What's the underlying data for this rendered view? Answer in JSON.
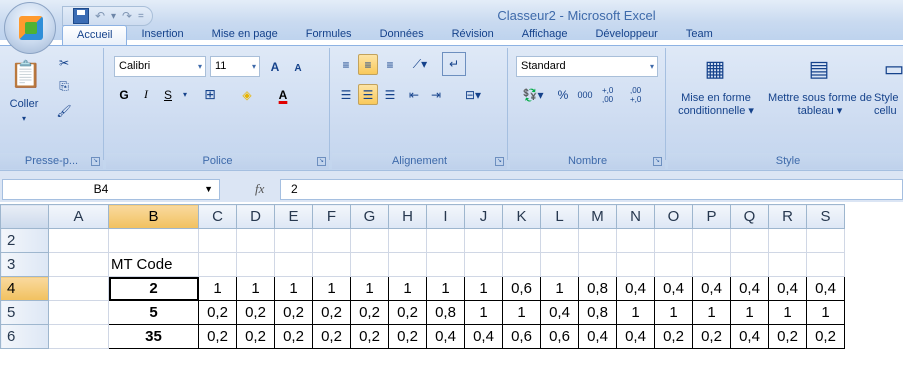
{
  "window": {
    "title": "Classeur2 - Microsoft Excel"
  },
  "qat": {
    "save_icon": "save-icon",
    "undo_icon": "undo-icon",
    "redo_icon": "redo-icon",
    "sep": "="
  },
  "tabs": [
    "Accueil",
    "Insertion",
    "Mise en page",
    "Formules",
    "Données",
    "Révision",
    "Affichage",
    "Développeur",
    "Team"
  ],
  "ribbon": {
    "clipboard": {
      "label": "Presse-p...",
      "paste": "Coller"
    },
    "font": {
      "label": "Police",
      "name": "Calibri",
      "size": "11",
      "bold": "G",
      "italic": "I",
      "underline": "S",
      "grow": "A",
      "shrink": "A",
      "color_a": "A"
    },
    "alignment": {
      "label": "Alignement"
    },
    "number": {
      "label": "Nombre",
      "format": "Standard",
      "percent": "%",
      "thousands": "000",
      "inc_dec": "+,0 ,00",
      "dec_dec": ",00 +,0"
    },
    "style": {
      "label": "Style",
      "cond": "Mise en forme conditionnelle ▾",
      "table": "Mettre sous forme de tableau ▾",
      "cell": "Style cellu"
    }
  },
  "formula_bar": {
    "name_box": "B4",
    "fx": "fx",
    "value": "2"
  },
  "grid": {
    "columns": [
      "A",
      "B",
      "C",
      "D",
      "E",
      "F",
      "G",
      "H",
      "I",
      "J",
      "K",
      "L",
      "M",
      "N",
      "O",
      "P",
      "Q",
      "R",
      "S"
    ],
    "rows": [
      {
        "num": "2",
        "cells": [
          "",
          "",
          "",
          "",
          "",
          "",
          "",
          "",
          "",
          "",
          "",
          "",
          "",
          "",
          "",
          "",
          "",
          "",
          ""
        ]
      },
      {
        "num": "3",
        "cells": [
          "",
          "MT Code",
          "",
          "",
          "",
          "",
          "",
          "",
          "",
          "",
          "",
          "",
          "",
          "",
          "",
          "",
          "",
          "",
          ""
        ]
      },
      {
        "num": "4",
        "cells": [
          "",
          "2",
          "1",
          "1",
          "1",
          "1",
          "1",
          "1",
          "1",
          "1",
          "0,6",
          "1",
          "0,8",
          "0,4",
          "0,4",
          "0,4",
          "0,4",
          "0,4",
          "0,4"
        ]
      },
      {
        "num": "5",
        "cells": [
          "",
          "5",
          "0,2",
          "0,2",
          "0,2",
          "0,2",
          "0,2",
          "0,2",
          "0,8",
          "1",
          "1",
          "0,4",
          "0,8",
          "1",
          "1",
          "1",
          "1",
          "1",
          "1"
        ]
      },
      {
        "num": "6",
        "cells": [
          "",
          "35",
          "0,2",
          "0,2",
          "0,2",
          "0,2",
          "0,2",
          "0,2",
          "0,4",
          "0,4",
          "0,6",
          "0,6",
          "0,4",
          "0,4",
          "0,2",
          "0,2",
          "0,4",
          "0,2",
          "0,2"
        ]
      }
    ]
  }
}
